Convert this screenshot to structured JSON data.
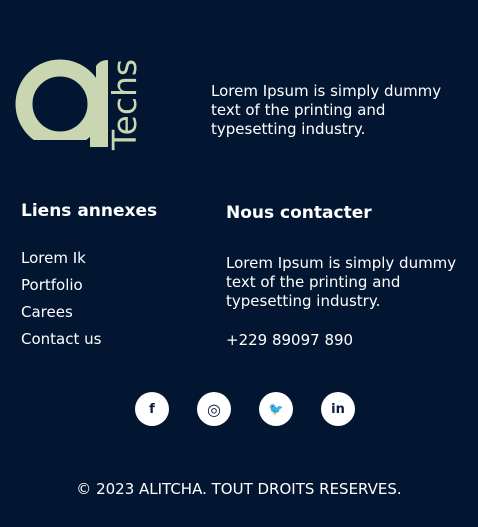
{
  "brand": {
    "logo_text": "Techs",
    "logo_color": "#c9d6b1",
    "background": "#021631"
  },
  "tagline": "Lorem Ipsum is simply dummy text of the printing and typesetting industry.",
  "links": {
    "title": "Liens annexes",
    "items": [
      {
        "label": "Lorem Ik"
      },
      {
        "label": "Portfolio"
      },
      {
        "label": "Carees"
      },
      {
        "label": "Contact us"
      }
    ]
  },
  "contact": {
    "title": "Nous contacter",
    "text": "Lorem Ipsum is simply dummy text of the printing and typesetting industry.",
    "phone": "+229 89097 890"
  },
  "social": [
    {
      "icon": "facebook-icon",
      "glyph": "f"
    },
    {
      "icon": "instagram-icon",
      "glyph": "◎"
    },
    {
      "icon": "twitter-icon",
      "glyph": "🐦"
    },
    {
      "icon": "linkedin-icon",
      "glyph": "in"
    }
  ],
  "copyright": "© 2023 ALITCHA. TOUT DROITS RESERVES."
}
